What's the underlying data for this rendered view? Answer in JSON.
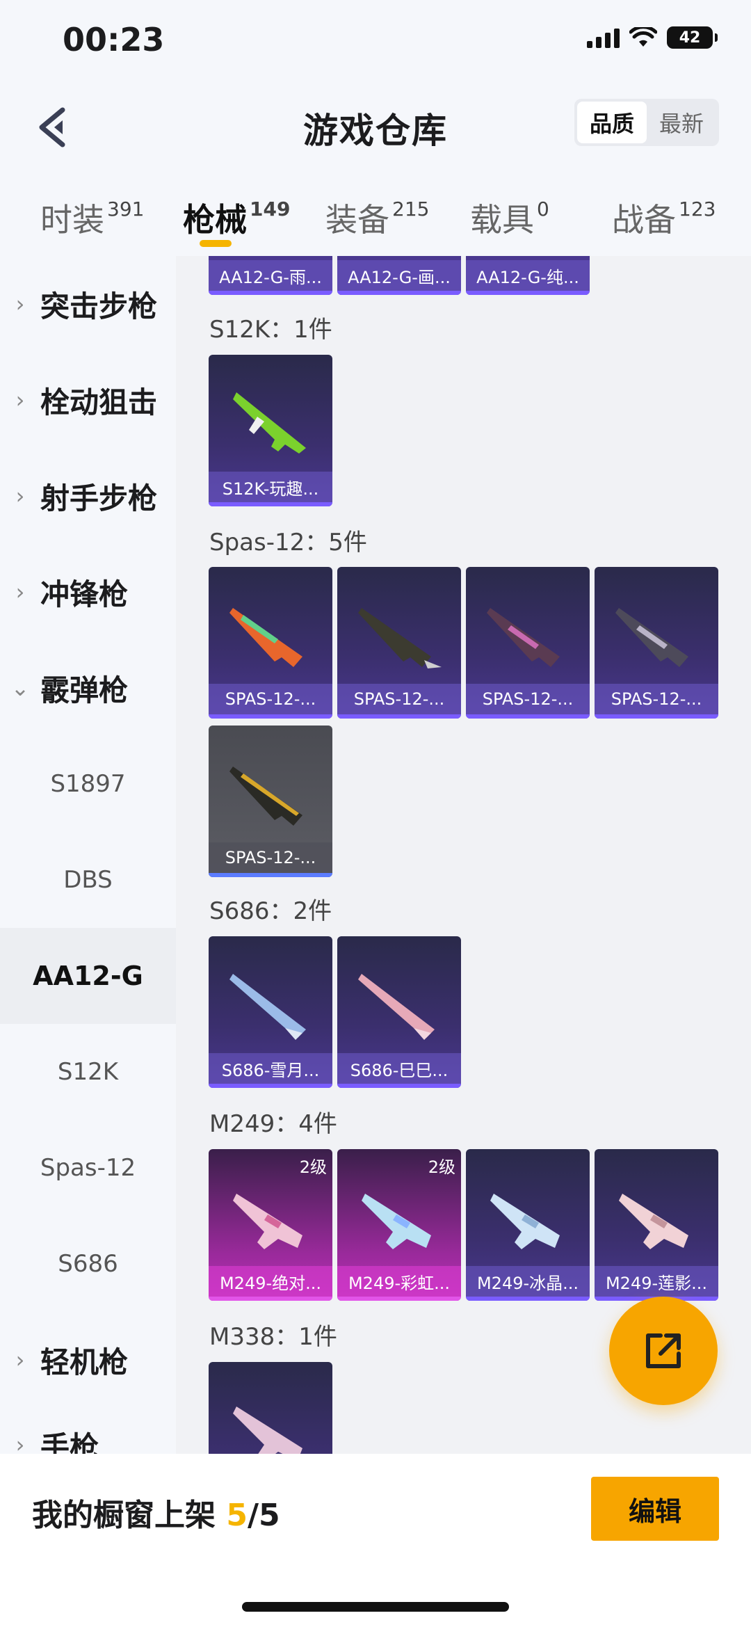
{
  "status": {
    "time": "00:23",
    "battery": "42"
  },
  "header": {
    "title": "游戏仓库",
    "sort_quality": "品质",
    "sort_latest": "最新"
  },
  "tabs": [
    {
      "label": "时装",
      "count": "391"
    },
    {
      "label": "枪械",
      "count": "149"
    },
    {
      "label": "装备",
      "count": "215"
    },
    {
      "label": "载具",
      "count": "0"
    },
    {
      "label": "战备",
      "count": "123"
    }
  ],
  "sidebar": {
    "categories": [
      "突击步枪",
      "栓动狙击",
      "射手步枪",
      "冲锋枪",
      "霰弹枪",
      "轻机枪",
      "手枪"
    ],
    "subitems": [
      "S1897",
      "DBS",
      "AA12-G",
      "S12K",
      "Spas-12",
      "S686"
    ]
  },
  "sections": {
    "top_row": [
      "AA12-G-雨...",
      "AA12-G-画...",
      "AA12-G-纯..."
    ],
    "s12k": {
      "title": "S12K：1件",
      "items": [
        "S12K-玩趣..."
      ]
    },
    "spas": {
      "title": "Spas-12：5件",
      "items": [
        "SPAS-12-...",
        "SPAS-12-...",
        "SPAS-12-...",
        "SPAS-12-...",
        "SPAS-12-..."
      ]
    },
    "s686": {
      "title": "S686：2件",
      "items": [
        "S686-雪月...",
        "S686-巳巳..."
      ]
    },
    "m249": {
      "title": "M249：4件",
      "items": [
        "M249-绝对...",
        "M249-彩虹...",
        "M249-冰晶...",
        "M249-莲影..."
      ],
      "level": "2级"
    },
    "m338": {
      "title": "M338：1件"
    }
  },
  "bottom": {
    "showcase_label": "我的橱窗上架",
    "showcase_current": "5",
    "showcase_total": "/5",
    "edit_label": "编辑"
  },
  "colors": {
    "accent": "#f7a500",
    "purple_card": "#4a3890",
    "pink_card": "#b531b5"
  }
}
